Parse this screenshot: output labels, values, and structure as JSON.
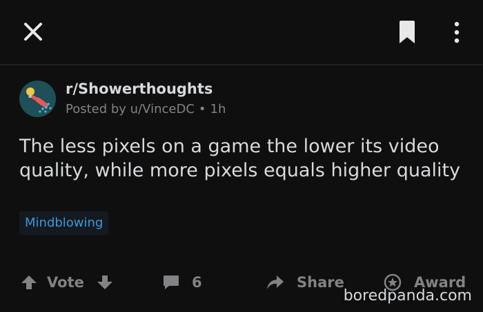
{
  "header": {
    "close_icon": "close-icon",
    "bookmark_icon": "bookmark-icon",
    "more_icon": "more-vertical-icon"
  },
  "post": {
    "subreddit": "r/Showerthoughts",
    "posted_by": "Posted by u/VinceDC",
    "separator": "•",
    "age": "1h",
    "title": "The less pixels on a game the lower its video quality, while more pixels equals higher quality",
    "flair": "Mindblowing"
  },
  "actions": {
    "vote_label": "Vote",
    "comment_count": "6",
    "share_label": "Share",
    "award_label": "Award"
  },
  "watermark": "boredpanda.com",
  "colors": {
    "background": "#0f0f10",
    "text": "#d7dadc",
    "muted": "#818384",
    "flair_text": "#3a9ad9"
  }
}
